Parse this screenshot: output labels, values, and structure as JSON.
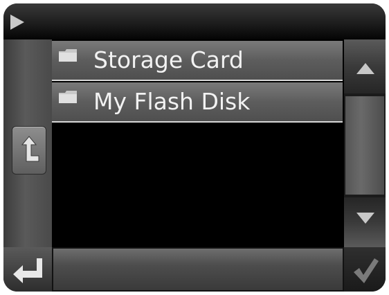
{
  "top_bar": {
    "arrow_icon": "play-arrow-icon"
  },
  "file_list": {
    "items": [
      {
        "label": "Storage Card",
        "icon": "folder-icon"
      },
      {
        "label": "My Flash Disk",
        "icon": "folder-icon"
      }
    ]
  },
  "sidebar_left": {
    "up_button_icon": "up-folder-arrow-icon"
  },
  "scroll": {
    "up_icon": "triangle-up-icon",
    "down_icon": "triangle-down-icon"
  },
  "bottom_bar": {
    "back_icon": "return-arrow-icon",
    "path_value": "",
    "ok_icon": "checkmark-icon"
  },
  "colors": {
    "background": "#000000",
    "row": "#666666",
    "text": "#f2f2f2",
    "icon": "#c8c8c8"
  }
}
